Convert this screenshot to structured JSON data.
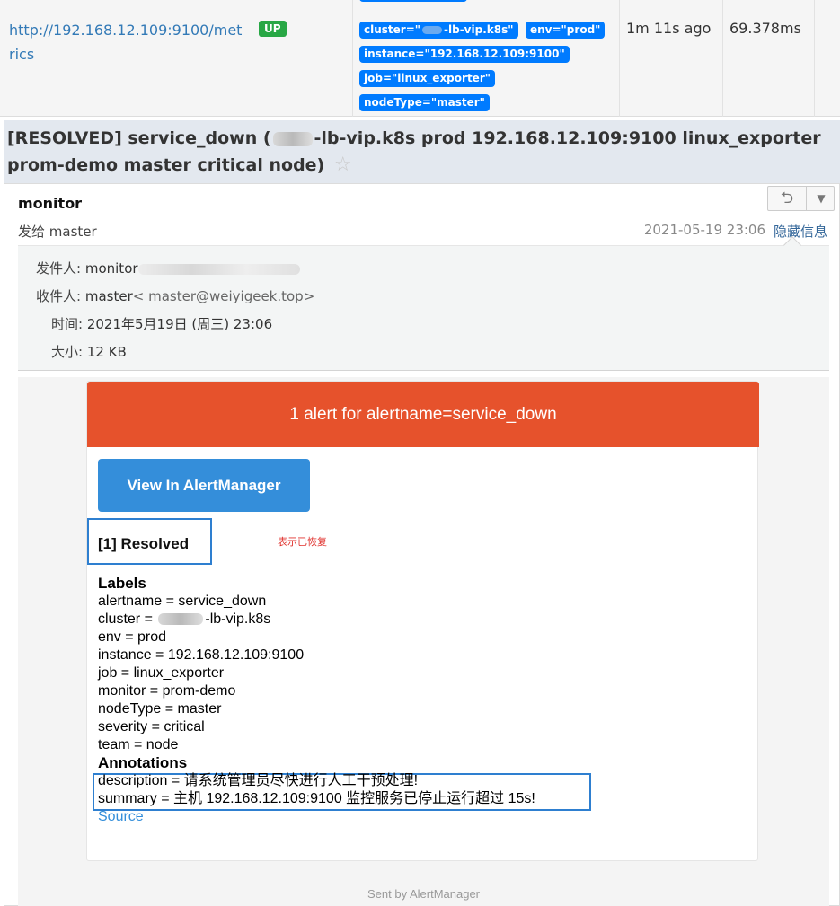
{
  "targets_table": {
    "endpoint": "http://192.168.12.109:9100/metrics",
    "state": "UP",
    "labels": [
      "cluster=\"",
      "-lb-vip.k8s\"",
      "env=\"prod\"",
      "instance=\"192.168.12.109:9100\"",
      "job=\"linux_exporter\"",
      "nodeType=\"master\""
    ],
    "last_scrape": "1m 11s ago",
    "scrape_duration": "69.378ms"
  },
  "email": {
    "subject_prefix": "[RESOLVED] service_down (",
    "subject_rest": "-lb-vip.k8s prod 192.168.12.109:9100 linux_exporter prom-demo master critical node)",
    "star_icon": "☆",
    "sender": "monitor",
    "to_line": "发给 master",
    "date": "2021-05-19 23:06",
    "hide_details": "隐藏信息",
    "details": {
      "from_key": "发件人:",
      "from_value": "monitor",
      "to_key": "收件人:",
      "to_value": "master",
      "to_addr": "< master@weiyigeek.top>",
      "time_key": "时间:",
      "time_value": "2021年5月19日 (周三) 23:06",
      "size_key": "大小:",
      "size_value": "12 KB"
    }
  },
  "alert": {
    "header": "1 alert for alertname=service_down",
    "view_button": "View In AlertManager",
    "resolved_title": "[1] Resolved",
    "resolved_note": "表示已恢复",
    "labels_heading": "Labels",
    "labels": {
      "alertname": "alertname = service_down",
      "cluster_prefix": "cluster = ",
      "cluster_suffix": "-lb-vip.k8s",
      "env": "env = prod",
      "instance": "instance = 192.168.12.109:9100",
      "job": "job = linux_exporter",
      "monitor": "monitor = prom-demo",
      "nodeType": "nodeType = master",
      "severity": "severity = critical",
      "team": "team = node"
    },
    "annotations_heading": "Annotations",
    "description": "description = 请系统管理员尽快进行人工干预处理!",
    "summary": "summary = 主机 192.168.12.109:9100 监控服务已停止运行超过 15s!",
    "source_link": "Source",
    "footer": "Sent by AlertManager"
  },
  "colors": {
    "alert_header": "#e6522c",
    "button": "#348eda",
    "badge": "#007bff",
    "up": "#28a745",
    "highlight_box": "#2e7fd0"
  }
}
